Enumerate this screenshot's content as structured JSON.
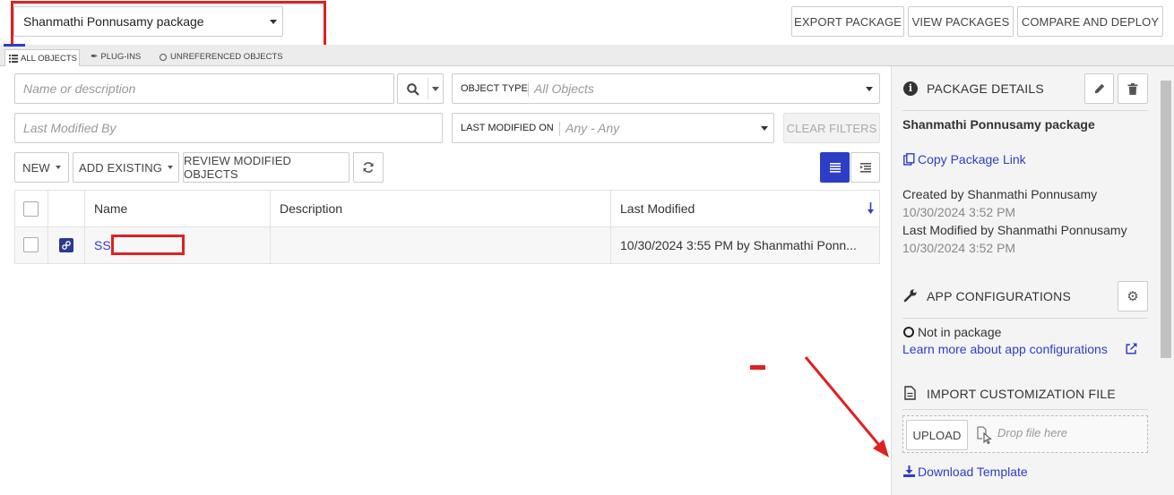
{
  "header": {
    "package_select": "Shanmathi Ponnusamy package",
    "export_label": "EXPORT PACKAGE",
    "view_label": "VIEW PACKAGES",
    "compare_label": "COMPARE AND DEPLOY"
  },
  "tabs": [
    {
      "label": "ALL OBJECTS"
    },
    {
      "label": "PLUG-INS"
    },
    {
      "label": "UNREFERENCED OBJECTS"
    }
  ],
  "filters": {
    "search_placeholder": "Name or description",
    "object_type_label": "OBJECT TYPE",
    "object_type_value": "All Objects",
    "modified_by_placeholder": "Last Modified By",
    "modified_on_label": "LAST MODIFIED ON",
    "modified_on_value": "Any - Any",
    "clear_label": "CLEAR FILTERS"
  },
  "toolbar": {
    "new_label": "NEW",
    "add_existing_label": "ADD EXISTING",
    "review_label": "REVIEW MODIFIED OBJECTS"
  },
  "table": {
    "columns": [
      "Name",
      "Description",
      "Last Modified"
    ],
    "rows": [
      {
        "name": "SS",
        "description": "",
        "last_modified": "10/30/2024 3:55 PM by Shanmathi Ponn..."
      }
    ]
  },
  "details": {
    "title": "PACKAGE DETAILS",
    "package_name": "Shanmathi Ponnusamy package",
    "copy_link": "Copy Package Link",
    "created_by": "Created by Shanmathi Ponnusamy",
    "created_on": "10/30/2024 3:52 PM",
    "modified_by": "Last Modified by Shanmathi Ponnusamy",
    "modified_on": "10/30/2024 3:52 PM"
  },
  "app_config": {
    "title": "APP CONFIGURATIONS",
    "status": "Not in package",
    "learn_more": "Learn more about app configurations"
  },
  "import": {
    "title": "IMPORT CUSTOMIZATION FILE",
    "upload_label": "UPLOAD",
    "drop_placeholder": "Drop file here",
    "download_label": "Download Template"
  },
  "colors": {
    "accent": "#2d3ec6",
    "annotation_red": "#e02020",
    "sidebar_bg": "#f4f4f4"
  }
}
